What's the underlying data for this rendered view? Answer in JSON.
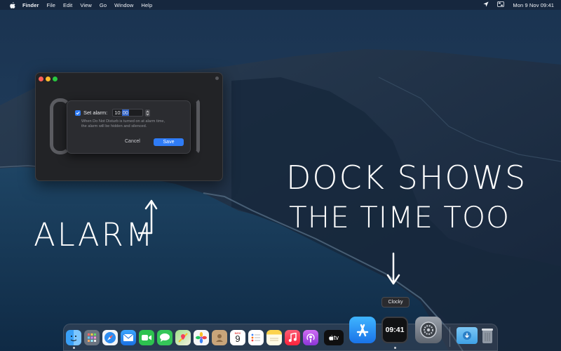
{
  "menubar": {
    "app_name": "Finder",
    "menus": [
      "File",
      "Edit",
      "View",
      "Go",
      "Window",
      "Help"
    ],
    "clock": "Mon 9 Nov  09:41",
    "status_icons": [
      "location-arrow-icon",
      "control-center-icon"
    ]
  },
  "alarm_sheet": {
    "checkbox_checked": true,
    "label": "Set alarm:",
    "time_hours": "10:",
    "time_minutes": "00",
    "note_line1": "When Do Not Disturb is turned on at alarm time,",
    "note_line2": "the alarm will be hidden and silenced.",
    "cancel_label": "Cancel",
    "save_label": "Save"
  },
  "annotations": {
    "alarm": "ALARM",
    "dock_line1": "DOCK SHOWS",
    "dock_line2": "THE TIME TOO"
  },
  "dock": {
    "tooltip": "Clocky",
    "calendar_month": "NOV",
    "calendar_day": "9",
    "tv_label": "tv",
    "clocky_time": "09:41",
    "apps": [
      "finder-icon",
      "launchpad-icon",
      "safari-icon",
      "mail-icon",
      "facetime-icon",
      "messages-icon",
      "maps-icon",
      "photos-icon",
      "contacts-icon",
      "calendar-icon",
      "reminders-icon",
      "notes-icon",
      "music-icon",
      "podcasts-icon",
      "apple-tv-icon",
      "app-store-icon",
      "clocky-icon",
      "system-preferences-icon",
      "downloads-folder-icon",
      "trash-icon"
    ]
  },
  "colors": {
    "accent": "#2f7cf6",
    "window_bg": "#222326",
    "sheet_bg": "#2b2c30"
  }
}
